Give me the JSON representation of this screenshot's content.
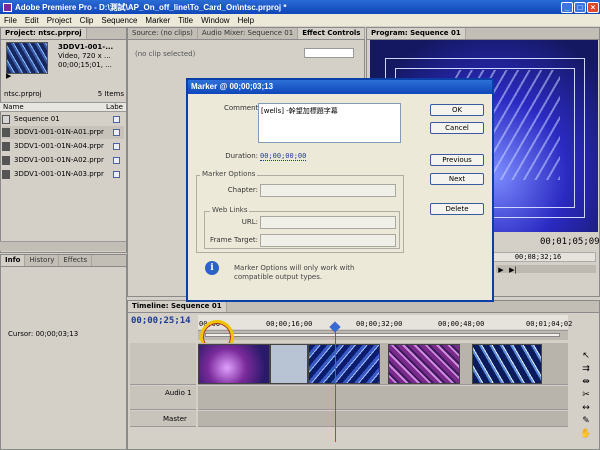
{
  "window": {
    "title": "Adobe Premiere Pro - D:\\測試\\AP_On_off_line\\To_Card_On\\ntsc.prproj *"
  },
  "menu": [
    "File",
    "Edit",
    "Project",
    "Clip",
    "Sequence",
    "Marker",
    "Title",
    "Window",
    "Help"
  ],
  "project": {
    "tab": "Project: ntsc.prproj",
    "clip_name": "3DDV1-001-...",
    "clip_line2": "Video, 720 x ...",
    "clip_line3": "00;00;15;01, ...",
    "bin_name": "ntsc.prproj",
    "item_count": "5 Items",
    "col_name": "Name",
    "col_label": "Labe",
    "items": [
      {
        "name": "Sequence 01"
      },
      {
        "name": "3DDV1-001-01N-A01.prpr"
      },
      {
        "name": "3DDV1-001-01N-A04.prpr"
      },
      {
        "name": "3DDV1-001-01N-A02.prpr"
      },
      {
        "name": "3DDV1-001-01N-A03.prpr"
      }
    ]
  },
  "info_panel": {
    "tabs": [
      "Info",
      "History",
      "Effects"
    ],
    "cursor": "Cursor: 00;00;03;13"
  },
  "source_panel": {
    "tabs": [
      "Source: (no clips)",
      "Audio Mixer: Sequence 01",
      "Effect Controls"
    ],
    "no_clip": "(no clip selected)"
  },
  "program": {
    "tab": "Program: Sequence 01",
    "timecode": "00;01;05;09",
    "ruler": "00;08;32;16"
  },
  "timeline": {
    "tab": "Timeline: Sequence 01",
    "current_time": "00;00;25;14",
    "ruler_labels": [
      "00;00",
      "00;00;16;00",
      "00;00;32;00",
      "00;00;48;00",
      "00;01;04;02"
    ],
    "audio_track": "Audio 1",
    "master_track": "Master"
  },
  "dialog": {
    "title": "Marker @ 00;00;03;13",
    "comments_label": "Comments:",
    "comments_value": "[wells]  -幹望加標題字幕",
    "duration_label": "Duration:",
    "duration_value": "00;00;00;00",
    "marker_options": "Marker Options",
    "chapter_label": "Chapter:",
    "web_links": "Web Links",
    "url_label": "URL:",
    "frame_target_label": "Frame Target:",
    "info_text": "Marker Options will only work with compatible output types.",
    "buttons": {
      "ok": "OK",
      "cancel": "Cancel",
      "previous": "Previous",
      "next": "Next",
      "delete": "Delete"
    }
  }
}
